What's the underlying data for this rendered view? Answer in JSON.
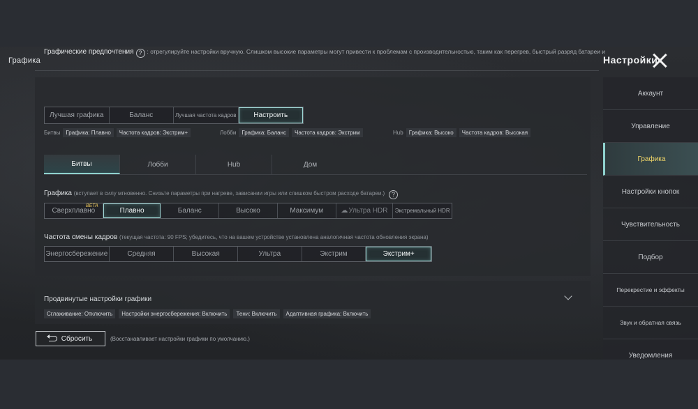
{
  "header": {
    "page_title": "Графика",
    "settings_title": "Настройки"
  },
  "preferences": {
    "label": "Графические предпочтения",
    "note": ": отрегулируйте настройки вручную. Слишком высокие параметры могут привести к проблемам с производительностью, таким как перегрев, быстрый разряд батареи и",
    "options": [
      "Лучшая графика",
      "Баланс",
      "Лучшая частота кадров",
      "Настроить"
    ],
    "selected": "Настроить"
  },
  "presets": [
    {
      "mode": "Битвы",
      "graphics": "Графика: Плавно",
      "fps": "Частота кадров: Экстрим+"
    },
    {
      "mode": "Лобби",
      "graphics": "Графика: Баланс",
      "fps": "Частота кадров: Экстрим"
    },
    {
      "mode": "Hub",
      "graphics": "Графика: Высоко",
      "fps": "Частота кадров: Высокая"
    }
  ],
  "tabs": [
    "Битвы",
    "Лобби",
    "Hub",
    "Дом"
  ],
  "active_tab": "Битвы",
  "graphics": {
    "label": "Графика",
    "note": "(вступает в силу мгновенно. Снизьте параметры при нагреве, зависании игры или слишком быстром расходе батареи.)",
    "options": [
      "Сверхплавно",
      "Плавно",
      "Баланс",
      "Высоко",
      "Максимум",
      "Ультра HDR",
      "Экстремальный HDR"
    ],
    "beta_label": "BETA",
    "selected": "Плавно"
  },
  "framerate": {
    "label": "Частота смены кадров",
    "note": "(текущая частота: 90 FPS; убедитесь, что на вашем устройстве установлена аналогичная частота обновления экрана)",
    "options": [
      "Энергосбережение",
      "Средняя",
      "Высокая",
      "Ультра",
      "Экстрим",
      "Экстрим+"
    ],
    "selected": "Экстрим+"
  },
  "advanced": {
    "title": "Продвинутые настройки графики",
    "tags": [
      "Сглаживание: Отключить",
      "Настройки энергосбережения: Включить",
      "Тени: Включить",
      "Адаптивная графика: Включить"
    ]
  },
  "reset": {
    "label": "Сбросить",
    "note": "(Восстанавливает настройки графики по умолчанию.)"
  },
  "sidebar": {
    "items": [
      "Аккаунт",
      "Управление",
      "Графика",
      "Настройки кнопок",
      "Чувствительность",
      "Подбор",
      "Перекрестие и эффекты",
      "Звук и обратная связь",
      "Уведомления"
    ],
    "active": "Графика"
  },
  "colors": {
    "accent": "#8fd2ce",
    "active_sidebar_text": "#f1d668",
    "beta": "#e8c457"
  }
}
